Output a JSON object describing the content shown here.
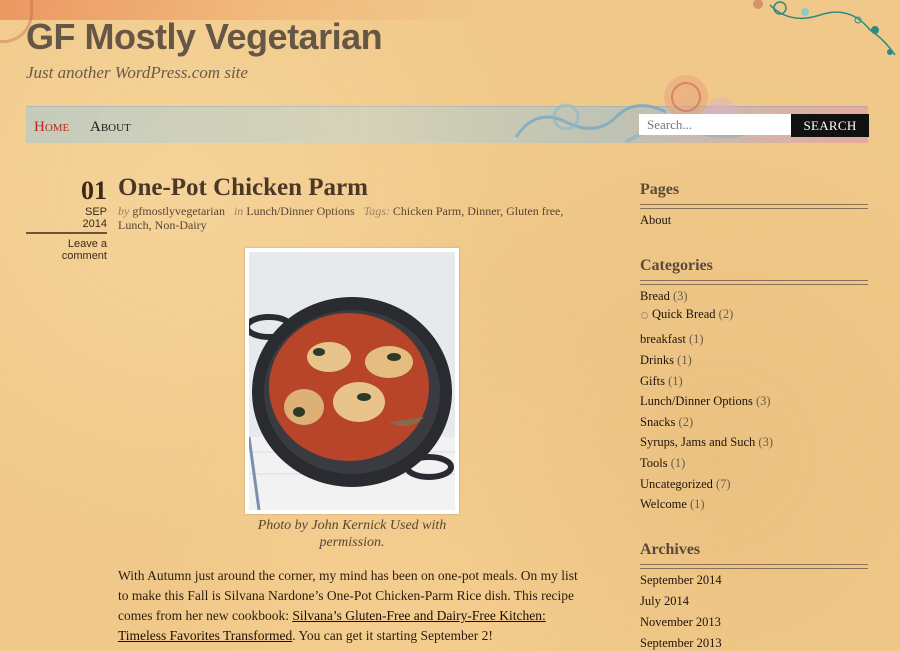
{
  "site": {
    "title": "GF Mostly Vegetarian",
    "description": "Just another WordPress.com site"
  },
  "nav": {
    "home_label": "Home",
    "about_label": "About",
    "search_placeholder": "Search...",
    "search_button_label": "SEARCH"
  },
  "post": {
    "date_day": "01",
    "date_month": "SEP",
    "date_year": "2014",
    "comment_link": "Leave a comment",
    "title": "One-Pot Chicken Parm",
    "by_label": "by",
    "author": "gfmostlyvegetarian",
    "in_label": "in",
    "category": "Lunch/Dinner Options",
    "tags_label": "Tags:",
    "tags": [
      "Chicken Parm",
      "Dinner",
      "Gluten free",
      "Lunch",
      "Non-Dairy"
    ],
    "caption": "Photo by John Kernick Used with permission.",
    "body_before_link": "With Autumn just around the corner, my mind has been on one-pot meals. On my list to make this Fall is Silvana Nardone’s One-Pot Chicken-Parm Rice dish. This recipe comes from her new cookbook: ",
    "body_link": "Silvana’s Gluten-Free and Dairy-Free Kitchen: Timeless Favorites Transformed",
    "body_after_link": ". You can get it starting September 2!"
  },
  "sidebar": {
    "pages_title": "Pages",
    "pages": [
      "About"
    ],
    "categories_title": "Categories",
    "categories": [
      {
        "name": "Bread",
        "count": "(3)"
      },
      {
        "name": "Quick Bread",
        "count": "(2)"
      },
      {
        "name": "breakfast",
        "count": "(1)"
      },
      {
        "name": "Drinks",
        "count": "(1)"
      },
      {
        "name": "Gifts",
        "count": "(1)"
      },
      {
        "name": "Lunch/Dinner Options",
        "count": "(3)"
      },
      {
        "name": "Snacks",
        "count": "(2)"
      },
      {
        "name": "Syrups, Jams and Such",
        "count": "(3)"
      },
      {
        "name": "Tools",
        "count": "(1)"
      },
      {
        "name": "Uncategorized",
        "count": "(7)"
      },
      {
        "name": "Welcome",
        "count": "(1)"
      }
    ],
    "archives_title": "Archives",
    "archives": [
      "September 2014",
      "July 2014",
      "November 2013",
      "September 2013"
    ]
  },
  "colors": {
    "background": "#f0c98a",
    "home_link": "#c0231b",
    "title": "#665646",
    "search_button": "#111111"
  }
}
